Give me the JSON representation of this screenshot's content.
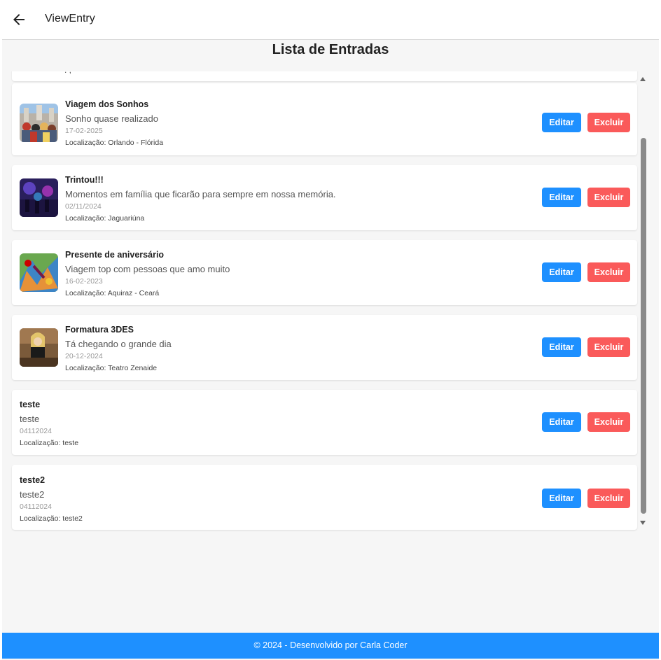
{
  "appbar": {
    "title": "ViewEntry",
    "back_icon": "arrow-left-icon"
  },
  "page": {
    "title": "Lista de Entradas"
  },
  "entries": [
    {
      "title": "Viagem dos Sonhos",
      "description": "Sonho quase realizado",
      "date": "17-02-2025",
      "location": "Localização: Orlando - Flórida",
      "edit_label": "Editar",
      "delete_label": "Excluir"
    },
    {
      "title": "Trintou!!!",
      "description": "Momentos em família que ficarão para sempre em nossa memória.",
      "date": "02/11/2024",
      "location": "Localização: Jaguariúna",
      "edit_label": "Editar",
      "delete_label": "Excluir"
    },
    {
      "title": "Presente de aniversário",
      "description": "Viagem top com pessoas que amo muito",
      "date": "16-02-2023",
      "location": "Localização: Aquiraz - Ceará",
      "edit_label": "Editar",
      "delete_label": "Excluir"
    },
    {
      "title": "Formatura 3DES",
      "description": "Tá chegando o grande dia",
      "date": "20-12-2024",
      "location": "Localização: Teatro Zenaide",
      "edit_label": "Editar",
      "delete_label": "Excluir"
    },
    {
      "title": "teste",
      "description": "teste",
      "date": "04112024",
      "location": "Localização: teste",
      "edit_label": "Editar",
      "delete_label": "Excluir"
    },
    {
      "title": "teste2",
      "description": "teste2",
      "date": "04112024",
      "location": "Localização: teste2",
      "edit_label": "Editar",
      "delete_label": "Excluir"
    }
  ],
  "footer": {
    "text": "© 2024 - Desenvolvido por Carla Coder"
  },
  "colors": {
    "primary": "#1e90ff",
    "danger": "#fa5a5a",
    "background": "#f6f6f6"
  }
}
